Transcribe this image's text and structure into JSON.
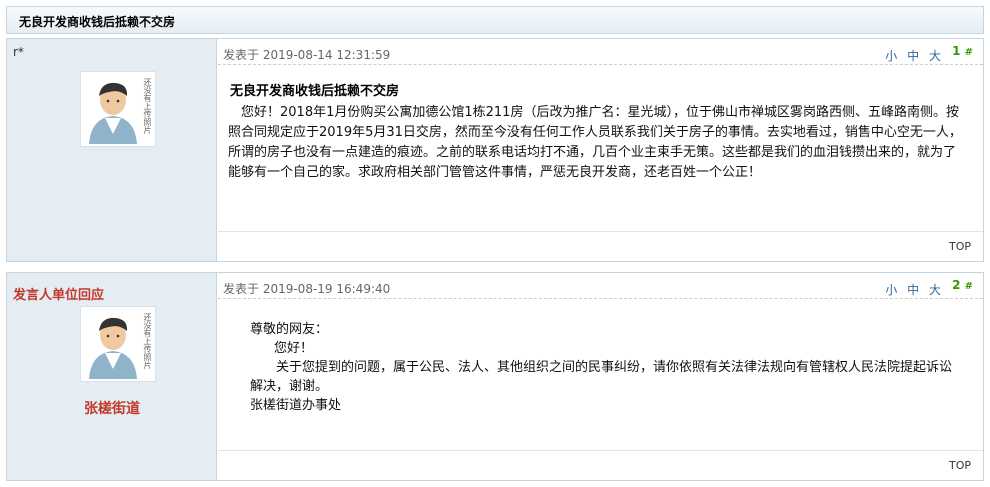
{
  "thread": {
    "title": "无良开发商收钱后抵赖不交房"
  },
  "avatar": {
    "caption": "还没有上传照片"
  },
  "size_links": [
    "小",
    "中",
    "大"
  ],
  "top_label": "TOP",
  "posts": [
    {
      "author": "r*",
      "time": "发表于 2019-08-14 12:31:59",
      "floor": "1",
      "floor_suffix": "#",
      "subject": "无良开发商收钱后抵赖不交房",
      "body": "　您好！2018年1月份购买公寓加德公馆1栋211房（后改为推广名：星光城），位于佛山市禅城区雾岗路西侧、五峰路南侧。按照合同规定应于2019年5月31日交房，然而至今没有任何工作人员联系我们关于房子的事情。去实地看过，销售中心空无一人，所谓的房子也没有一点建造的痕迹。之前的联系电话均打不通，几百个业主束手无策。这些都是我们的血泪钱攒出来的，就为了能够有一个自己的家。求政府相关部门管管这件事情，严惩无良开发商，还老百姓一个公正！"
    },
    {
      "author": "发言人单位回应",
      "org": "张槎街道",
      "time": "发表于 2019-08-19 16:49:40",
      "floor": "2",
      "floor_suffix": "#",
      "greeting": "尊敬的网友：",
      "salutation": "您好！",
      "body": "　　关于您提到的问题，属于公民、法人、其他组织之间的民事纠纷，请你依照有关法律法规向有管辖权人民法院提起诉讼解决，谢谢。",
      "signature": "张槎街道办事处"
    }
  ]
}
